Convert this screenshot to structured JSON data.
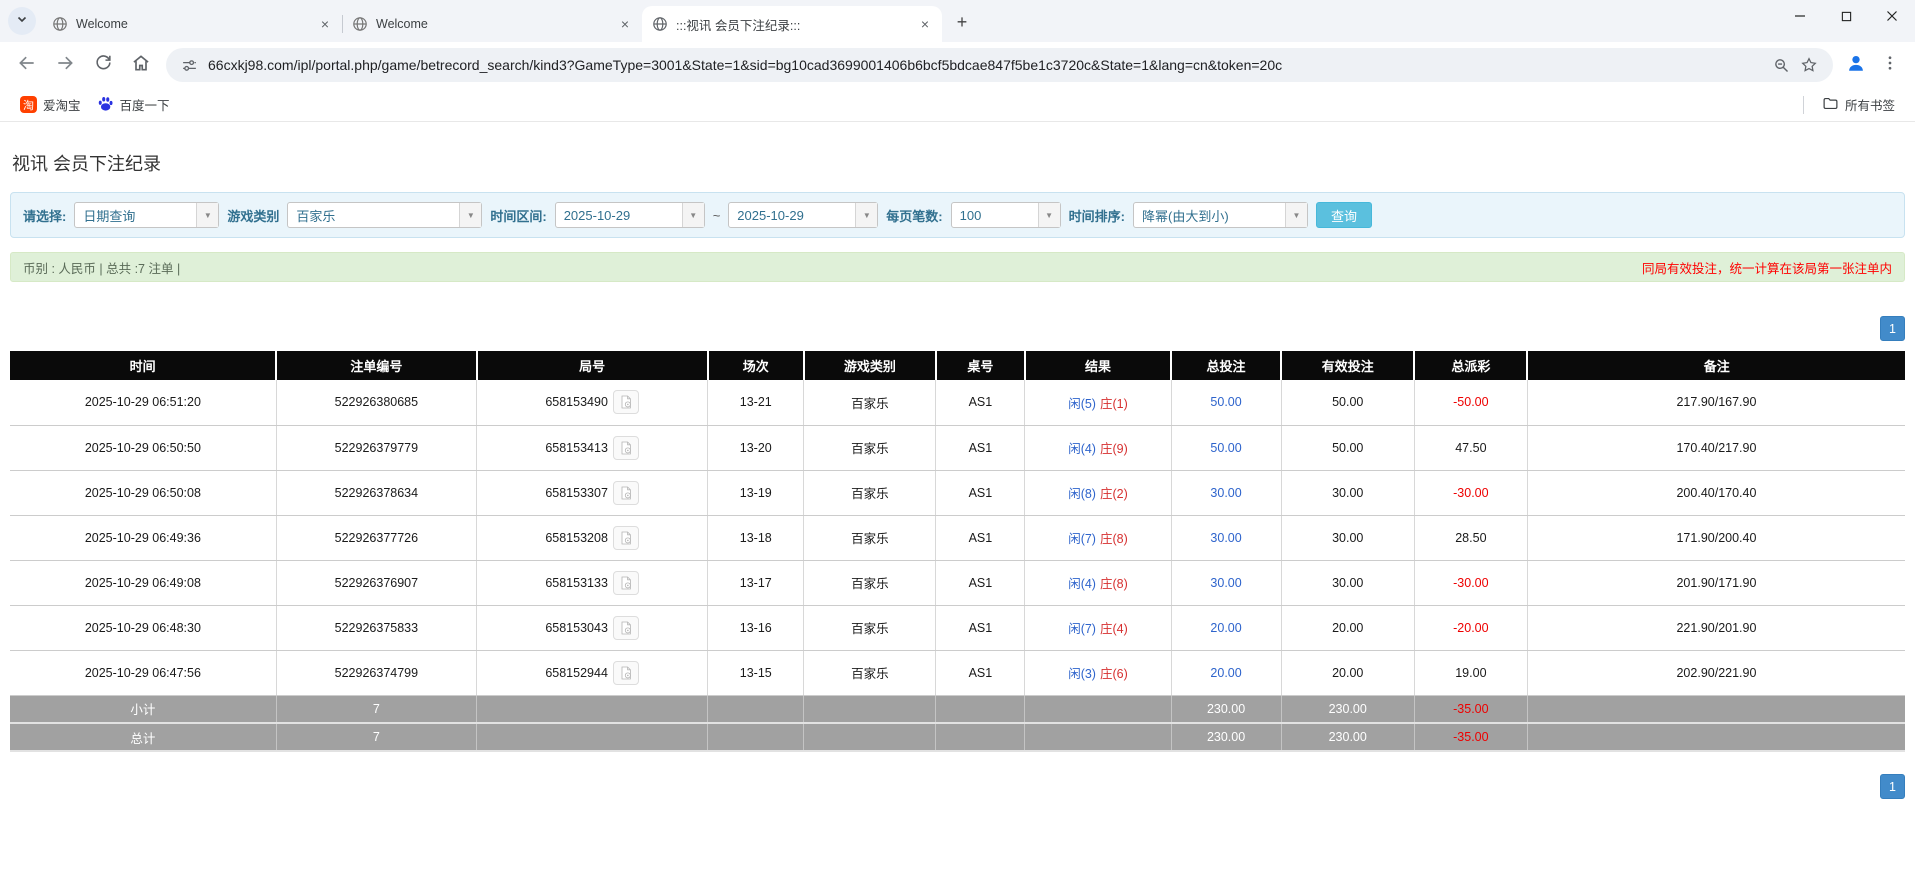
{
  "browser": {
    "tabs": [
      {
        "title": "Welcome"
      },
      {
        "title": "Welcome"
      },
      {
        "title": ":::视讯 会员下注纪录:::"
      }
    ],
    "url": "66cxkj98.com/ipl/portal.php/game/betrecord_search/kind3?GameType=3001&State=1&sid=bg10cad3699001406b6bcf5bdcae847f5be1c3720c&State=1&lang=cn&token=20c",
    "icons": {
      "new_tab": "+",
      "close_tab": "×",
      "dropdown_caret": "▼"
    },
    "bookmarks": {
      "taobao_label": "爱淘宝",
      "taobao_glyph": "淘",
      "baidu_label": "百度一下",
      "all_bookmarks_label": "所有书签"
    }
  },
  "page": {
    "title": "视讯 会员下注纪录",
    "filters": {
      "select_label": "请选择:",
      "select_value": "日期查询",
      "game_type_label": "游戏类别",
      "game_type_value": "百家乐",
      "date_range_label": "时间区间:",
      "date_from": "2025-10-29",
      "range_separator": "~",
      "date_to": "2025-10-29",
      "page_size_label": "每页笔数:",
      "page_size_value": "100",
      "sort_label": "时间排序:",
      "sort_value": "降幂(由大到小)",
      "search_button": "查询"
    },
    "summary": {
      "left": "币别 : 人民币 | 总共 :7 注单 |",
      "right": "同局有效投注，统一计算在该局第一张注单内"
    },
    "pagination": {
      "page": "1"
    },
    "colors": {
      "accent_blue": "#428bca",
      "search_button": "#5bc0de",
      "player_blue": "#2e64cc",
      "banker_red": "#d63030",
      "negative_red": "#ee0000",
      "header_black": "#0a0a0a",
      "summary_green": "#dff0d8"
    },
    "table": {
      "headers": [
        "时间",
        "注单编号",
        "局号",
        "场次",
        "游戏类别",
        "桌号",
        "结果",
        "总投注",
        "有效投注",
        "总派彩",
        "备注"
      ],
      "rows": [
        {
          "time": "2025-10-29 06:51:20",
          "bet_id": "522926380685",
          "round_id": "658153490",
          "session": "13-21",
          "game": "百家乐",
          "table_no": "AS1",
          "result_player": "闲(5)",
          "result_banker": "庄(1)",
          "total_bet": "50.00",
          "valid_bet": "50.00",
          "payout": "-50.00",
          "remark": "217.90/167.90"
        },
        {
          "time": "2025-10-29 06:50:50",
          "bet_id": "522926379779",
          "round_id": "658153413",
          "session": "13-20",
          "game": "百家乐",
          "table_no": "AS1",
          "result_player": "闲(4)",
          "result_banker": "庄(9)",
          "total_bet": "50.00",
          "valid_bet": "50.00",
          "payout": "47.50",
          "remark": "170.40/217.90"
        },
        {
          "time": "2025-10-29 06:50:08",
          "bet_id": "522926378634",
          "round_id": "658153307",
          "session": "13-19",
          "game": "百家乐",
          "table_no": "AS1",
          "result_player": "闲(8)",
          "result_banker": "庄(2)",
          "total_bet": "30.00",
          "valid_bet": "30.00",
          "payout": "-30.00",
          "remark": "200.40/170.40"
        },
        {
          "time": "2025-10-29 06:49:36",
          "bet_id": "522926377726",
          "round_id": "658153208",
          "session": "13-18",
          "game": "百家乐",
          "table_no": "AS1",
          "result_player": "闲(7)",
          "result_banker": "庄(8)",
          "total_bet": "30.00",
          "valid_bet": "30.00",
          "payout": "28.50",
          "remark": "171.90/200.40"
        },
        {
          "time": "2025-10-29 06:49:08",
          "bet_id": "522926376907",
          "round_id": "658153133",
          "session": "13-17",
          "game": "百家乐",
          "table_no": "AS1",
          "result_player": "闲(4)",
          "result_banker": "庄(8)",
          "total_bet": "30.00",
          "valid_bet": "30.00",
          "payout": "-30.00",
          "remark": "201.90/171.90"
        },
        {
          "time": "2025-10-29 06:48:30",
          "bet_id": "522926375833",
          "round_id": "658153043",
          "session": "13-16",
          "game": "百家乐",
          "table_no": "AS1",
          "result_player": "闲(7)",
          "result_banker": "庄(4)",
          "total_bet": "20.00",
          "valid_bet": "20.00",
          "payout": "-20.00",
          "remark": "221.90/201.90"
        },
        {
          "time": "2025-10-29 06:47:56",
          "bet_id": "522926374799",
          "round_id": "658152944",
          "session": "13-15",
          "game": "百家乐",
          "table_no": "AS1",
          "result_player": "闲(3)",
          "result_banker": "庄(6)",
          "total_bet": "20.00",
          "valid_bet": "20.00",
          "payout": "19.00",
          "remark": "202.90/221.90"
        }
      ],
      "subtotal": {
        "label": "小计",
        "count": "7",
        "total_bet": "230.00",
        "valid_bet": "230.00",
        "payout": "-35.00"
      },
      "total": {
        "label": "总计",
        "count": "7",
        "total_bet": "230.00",
        "valid_bet": "230.00",
        "payout": "-35.00"
      }
    }
  },
  "window": {
    "minimize": "–",
    "maximize": "▢",
    "close": "×"
  }
}
